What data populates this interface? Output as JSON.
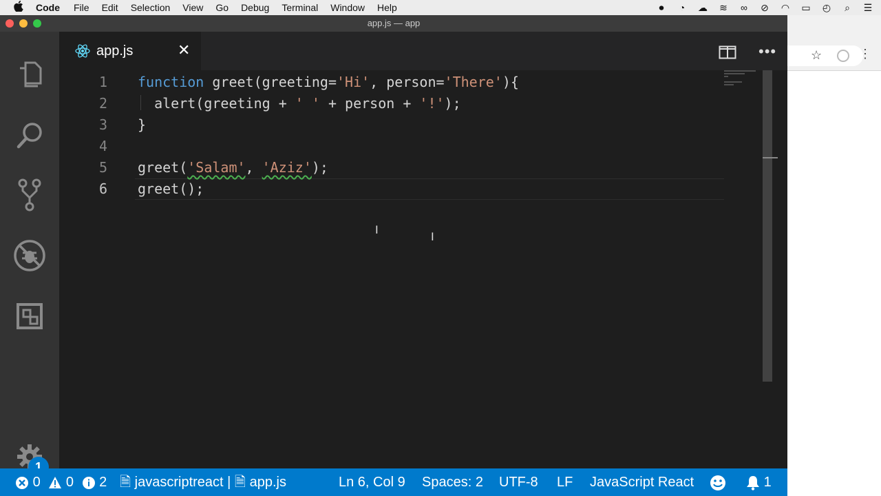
{
  "menubar": {
    "app_name": "Code",
    "items": [
      "File",
      "Edit",
      "Selection",
      "View",
      "Go",
      "Debug",
      "Terminal",
      "Window",
      "Help"
    ]
  },
  "window": {
    "title": "app.js — app"
  },
  "tab": {
    "label": "app.js",
    "close": "✕"
  },
  "editor": {
    "line_numbers": [
      "1",
      "2",
      "3",
      "4",
      "5",
      "6"
    ],
    "active_line": 6,
    "lines": [
      [
        {
          "t": "function",
          "c": "kw"
        },
        {
          "t": " greet(greeting=",
          "c": "pl"
        },
        {
          "t": "'Hi'",
          "c": "str"
        },
        {
          "t": ", person=",
          "c": "pl"
        },
        {
          "t": "'There'",
          "c": "str"
        },
        {
          "t": "){",
          "c": "pl"
        }
      ],
      [
        {
          "t": "  alert(greeting + ",
          "c": "pl"
        },
        {
          "t": "' '",
          "c": "str"
        },
        {
          "t": " + person + ",
          "c": "pl"
        },
        {
          "t": "'!'",
          "c": "str"
        },
        {
          "t": ");",
          "c": "pl"
        }
      ],
      [
        {
          "t": "}",
          "c": "pl"
        }
      ],
      [],
      [
        {
          "t": "greet(",
          "c": "pl"
        },
        {
          "t": "'Salam'",
          "c": "str squig"
        },
        {
          "t": ", ",
          "c": "pl"
        },
        {
          "t": "'Aziz'",
          "c": "str squig"
        },
        {
          "t": ");",
          "c": "pl"
        }
      ],
      [
        {
          "t": "greet();",
          "c": "pl"
        }
      ]
    ]
  },
  "activity": {
    "manage_badge": "1"
  },
  "status": {
    "errors": "0",
    "warnings": "0",
    "infos": "2",
    "language_id": "javascriptreact",
    "separator": "|",
    "file": "app.js",
    "position": "Ln 6, Col 9",
    "spaces": "Spaces: 2",
    "encoding": "UTF-8",
    "eol": "LF",
    "language": "JavaScript React",
    "notifications": "1"
  },
  "colors": {
    "statusbar": "#007acc",
    "keyword": "#569cd6",
    "string": "#ce9178",
    "editor_bg": "#1e1e1e"
  }
}
